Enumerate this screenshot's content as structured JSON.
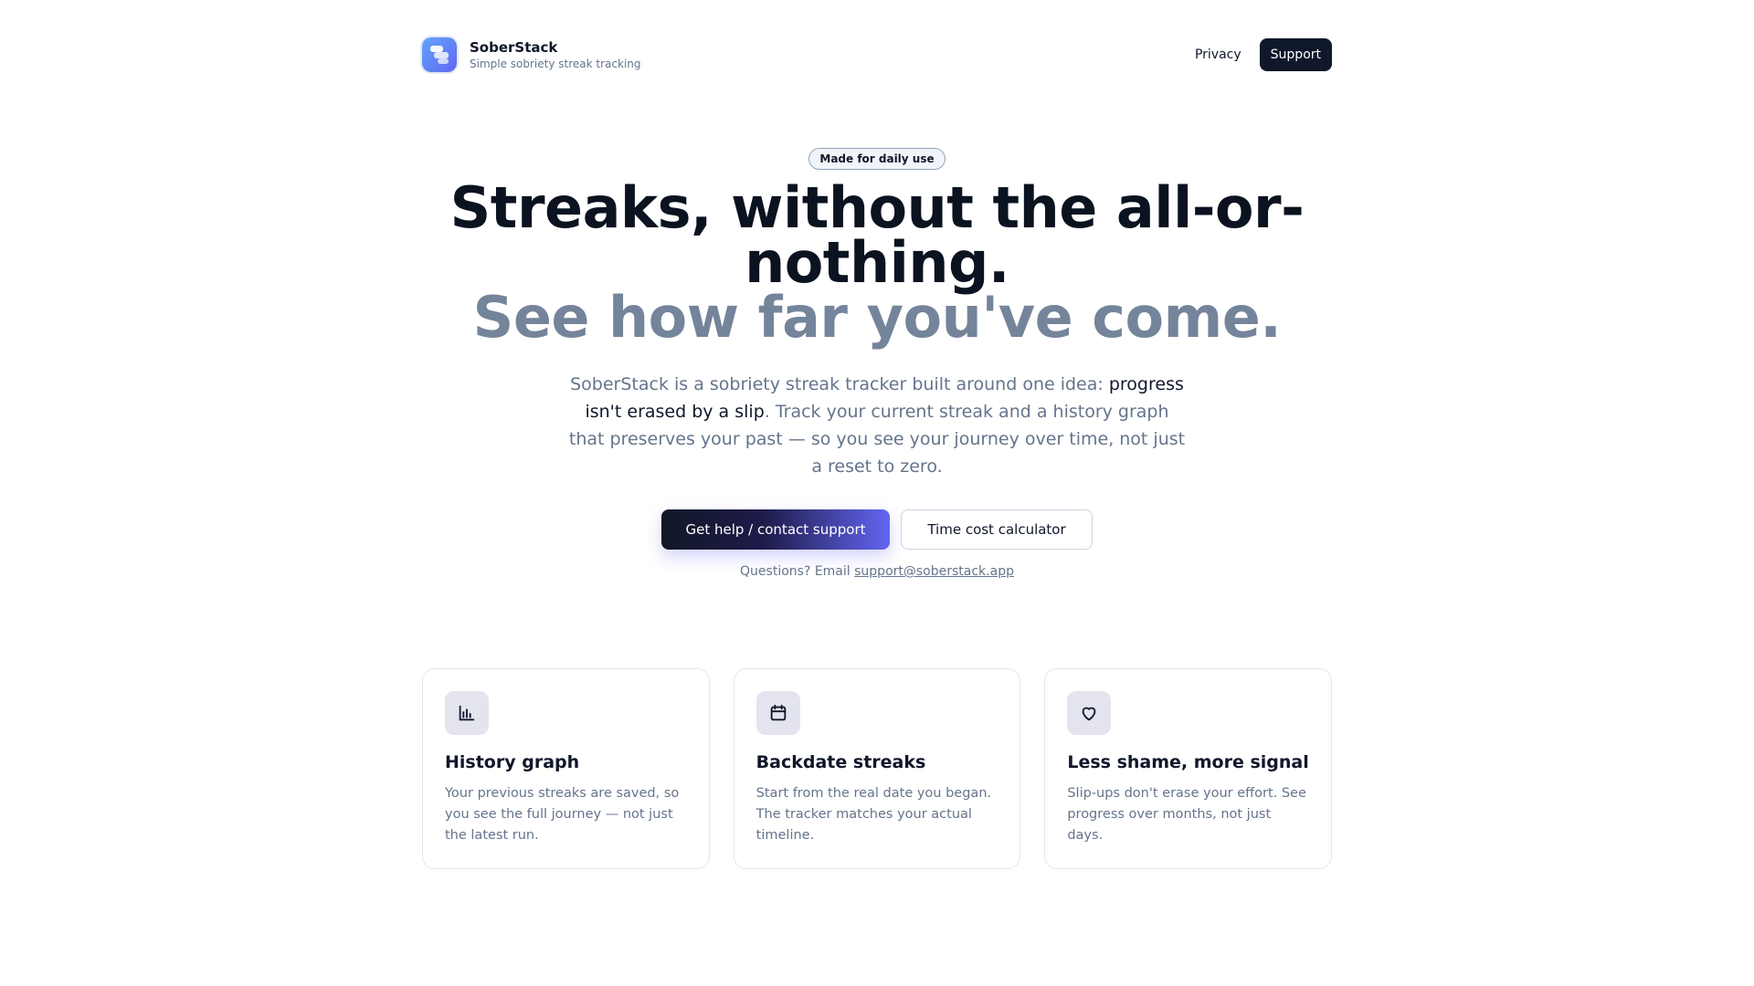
{
  "header": {
    "brand_name": "SoberStack",
    "brand_tagline": "Simple sobriety streak tracking",
    "nav_privacy": "Privacy",
    "nav_support": "Support"
  },
  "hero": {
    "badge": "Made for daily use",
    "title_line1": "Streaks, without the all-or-nothing.",
    "title_line2": "See how far you've come.",
    "lead_part1": "SoberStack is a sobriety streak tracker built around one idea: ",
    "lead_emphasis": "progress isn't erased by a slip",
    "lead_part2": ". Track your current streak and a history graph that preserves your past — so you see your journey over time, not just a reset to zero.",
    "cta_primary": "Get help / contact support",
    "cta_secondary": "Time cost calculator",
    "contact_prefix": "Questions? Email ",
    "contact_email": "support@soberstack.app"
  },
  "features": [
    {
      "icon": "bar-chart-icon",
      "title": "History graph",
      "text": "Your previous streaks are saved, so you see the full journey — not just the latest run."
    },
    {
      "icon": "calendar-icon",
      "title": "Backdate streaks",
      "text": "Start from the real date you began. The tracker matches your actual timeline."
    },
    {
      "icon": "heart-icon",
      "title": "Less shame, more signal",
      "text": "Slip-ups don't erase your effort. See progress over months, not just days."
    }
  ],
  "colors": {
    "brand_dark": "#0f172a",
    "accent": "#6366f1",
    "muted_heading": "#74849a",
    "body_text": "#64748b"
  }
}
